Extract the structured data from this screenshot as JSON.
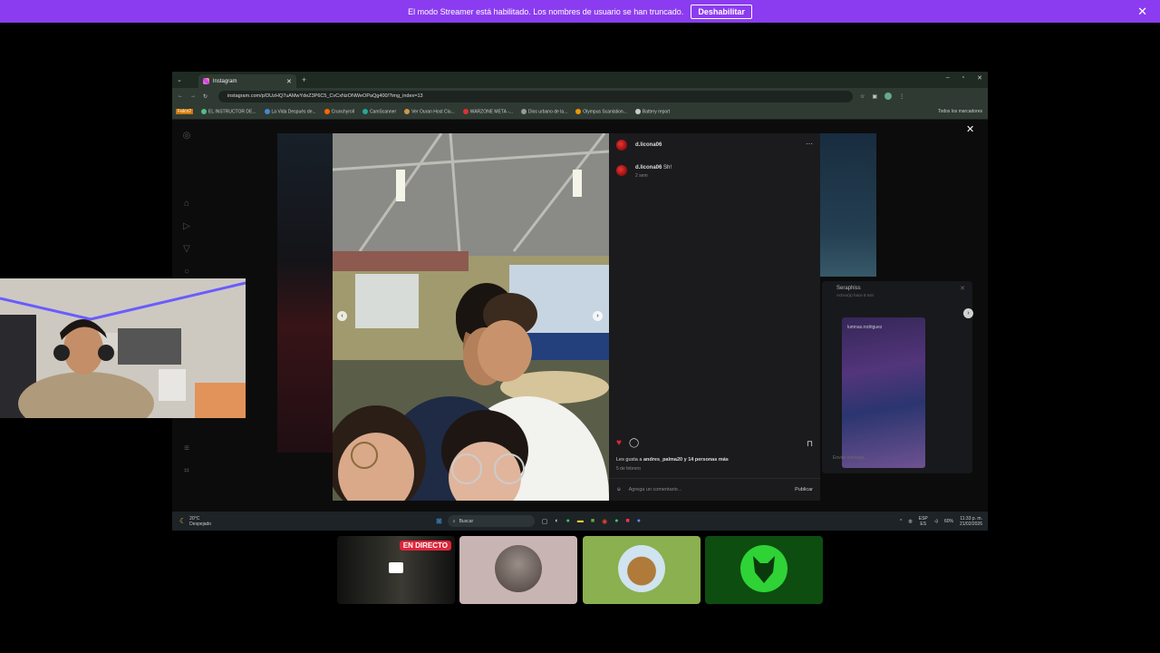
{
  "banner": {
    "message": "El modo Streamer está habilitado. Los nombres de usuario se han truncado.",
    "button_label": "Deshabilitar",
    "close_icon": "close-icon",
    "color": "#8b3cf0"
  },
  "browser": {
    "tab_title": "Instagram",
    "new_tab_symbol": "+",
    "url": "instagram.com/p/DUzHQ7uAMwYdeZ3P6C5_CvCxNzONWeOPaQg400/?img_index=13",
    "bookmarks": [
      "Falco2",
      "EL INSTRUCTOR DE...",
      "La Vida Después de...",
      "Crunchyroll",
      "CamScanner",
      "Ver Ouran Host Clu...",
      "WARZONE META -...",
      "Dios urbano de la...",
      "Olympus Scanlation...",
      "Battery report"
    ],
    "all_bookmarks": "Todos los marcadores"
  },
  "post": {
    "username": "d.licona06",
    "caption_user": "d.licona06",
    "caption_text": "Sh!",
    "caption_time": "2 sem",
    "likes_text_prefix": "Les gusta a ",
    "likes_user": "andres_palma20",
    "likes_text_suffix": " y 14 personas más",
    "date": "5 de febrero",
    "comment_placeholder": "Agrega un comentario...",
    "publish_label": "Publicar",
    "more_symbol": "···",
    "close_symbol": "✕"
  },
  "dm": {
    "name": "Seraphiss",
    "subtitle": "Activo(a) hace 8 min",
    "shared_user": "lumnas.rodriguez",
    "message_placeholder": "Enviar mensaje..."
  },
  "taskbar": {
    "weather_temp": "20°C",
    "weather_desc": "Despejado",
    "search_placeholder": "Buscar",
    "lang": "ESP",
    "lang_sub": "ES",
    "battery": "60%",
    "time": "11:33 p. m.",
    "date": "21/02/2026"
  },
  "tiles": {
    "live_badge": "EN DIRECTO"
  },
  "colors": {
    "heart": "#e0243a",
    "live": "#e0243a",
    "green_tile": "#8ab04f",
    "dark_green_tile": "#0d4d10"
  }
}
